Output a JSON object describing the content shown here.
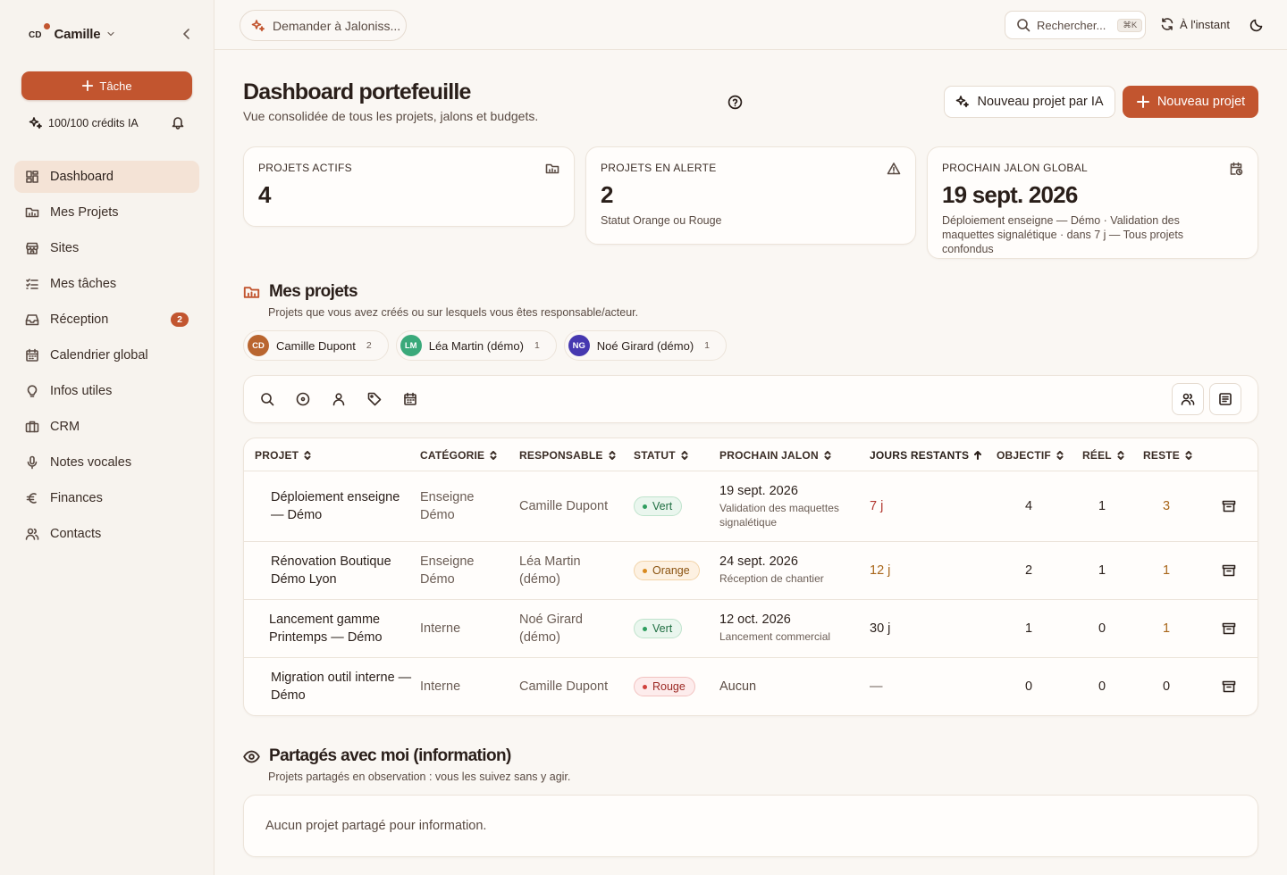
{
  "sidebar": {
    "user_initials": "CD",
    "user_name": "Camille",
    "task_button": "Tâche",
    "credits": "100/100 crédits IA",
    "items": [
      {
        "label": "Dashboard",
        "icon": "dashboard-icon",
        "active": true
      },
      {
        "label": "Mes Projets",
        "icon": "folder-icon"
      },
      {
        "label": "Sites",
        "icon": "store-icon"
      },
      {
        "label": "Mes tâches",
        "icon": "list-check-icon"
      },
      {
        "label": "Réception",
        "icon": "inbox-icon",
        "badge": "2"
      },
      {
        "label": "Calendrier global",
        "icon": "calendar-icon"
      },
      {
        "label": "Infos utiles",
        "icon": "lightbulb-icon"
      },
      {
        "label": "CRM",
        "icon": "briefcase-icon"
      },
      {
        "label": "Notes vocales",
        "icon": "mic-icon"
      },
      {
        "label": "Finances",
        "icon": "euro-icon"
      },
      {
        "label": "Contacts",
        "icon": "users-icon"
      }
    ]
  },
  "topbar": {
    "ask_label": "Demander à Jaloniss...",
    "search_placeholder": "Rechercher...",
    "search_shortcut": "⌘K",
    "sync_label": "À l'instant"
  },
  "header": {
    "title": "Dashboard portefeuille",
    "subtitle": "Vue consolidée de tous les projets, jalons et budgets.",
    "ai_button": "Nouveau projet par IA",
    "new_button": "Nouveau projet"
  },
  "stats": [
    {
      "label": "Projets actifs",
      "value": "4",
      "sub": "",
      "icon": "folder-icon"
    },
    {
      "label": "Projets en alerte",
      "value": "2",
      "sub": "Statut Orange ou Rouge",
      "icon": "warning-icon"
    },
    {
      "label": "Prochain jalon global",
      "value": "19 sept. 2026",
      "sub": "Déploiement enseigne — Démo · Validation des maquettes signalétique · dans 7 j — Tous projets confondus",
      "icon": "calendar-clock-icon"
    }
  ],
  "projects_section": {
    "title": "Mes projets",
    "subtitle": "Projets que vous avez créés ou sur lesquels vous êtes responsable/acteur."
  },
  "chips": [
    {
      "initials": "CD",
      "name": "Camille Dupont",
      "count": "2",
      "color": "#b9652f"
    },
    {
      "initials": "LM",
      "name": "Léa Martin (démo)",
      "count": "1",
      "color": "#3aa97a"
    },
    {
      "initials": "NG",
      "name": "Noé Girard (démo)",
      "count": "1",
      "color": "#4638b0"
    }
  ],
  "table": {
    "headers": {
      "projet": "Projet",
      "categorie": "Catégorie",
      "responsable": "Responsable",
      "statut": "Statut",
      "jalon": "Prochain jalon",
      "jours": "Jours restants",
      "objectif": "Objectif",
      "reel": "Réel",
      "reste": "Reste"
    },
    "rows": [
      {
        "projet": "Déploiement enseigne — Démo",
        "categorie": "Enseigne Démo",
        "responsable": "Camille Dupont",
        "statut": "Vert",
        "jalon_date": "19 sept. 2026",
        "jalon_label": "Validation des maquettes signalétique",
        "jours": "7 j",
        "objectif": "4",
        "reel": "1",
        "reste": "3"
      },
      {
        "projet": "Rénovation Boutique Démo Lyon",
        "categorie": "Enseigne Démo",
        "responsable": "Léa Martin (démo)",
        "statut": "Orange",
        "jalon_date": "24 sept. 2026",
        "jalon_label": "Réception de chantier",
        "jours": "12 j",
        "objectif": "2",
        "reel": "1",
        "reste": "1"
      },
      {
        "projet": "Lancement gamme Printemps — Démo",
        "categorie": "Interne",
        "responsable": "Noé Girard (démo)",
        "statut": "Vert",
        "jalon_date": "12 oct. 2026",
        "jalon_label": "Lancement commercial",
        "jours": "30 j",
        "objectif": "1",
        "reel": "0",
        "reste": "1"
      },
      {
        "projet": "Migration outil interne — Démo",
        "categorie": "Interne",
        "responsable": "Camille Dupont",
        "statut": "Rouge",
        "jalon_date": "Aucun",
        "jalon_label": "",
        "jours": "—",
        "objectif": "0",
        "reel": "0",
        "reste": "0"
      }
    ]
  },
  "shared_section": {
    "title": "Partagés avec moi (information)",
    "subtitle": "Projets partagés en observation : vous les suivez sans y agir.",
    "empty": "Aucun projet partagé pour information."
  },
  "colors": {
    "accent": "#c2552f",
    "status_green": "#2f9e5f",
    "status_orange": "#d98a1f",
    "status_red": "#d0413c"
  }
}
